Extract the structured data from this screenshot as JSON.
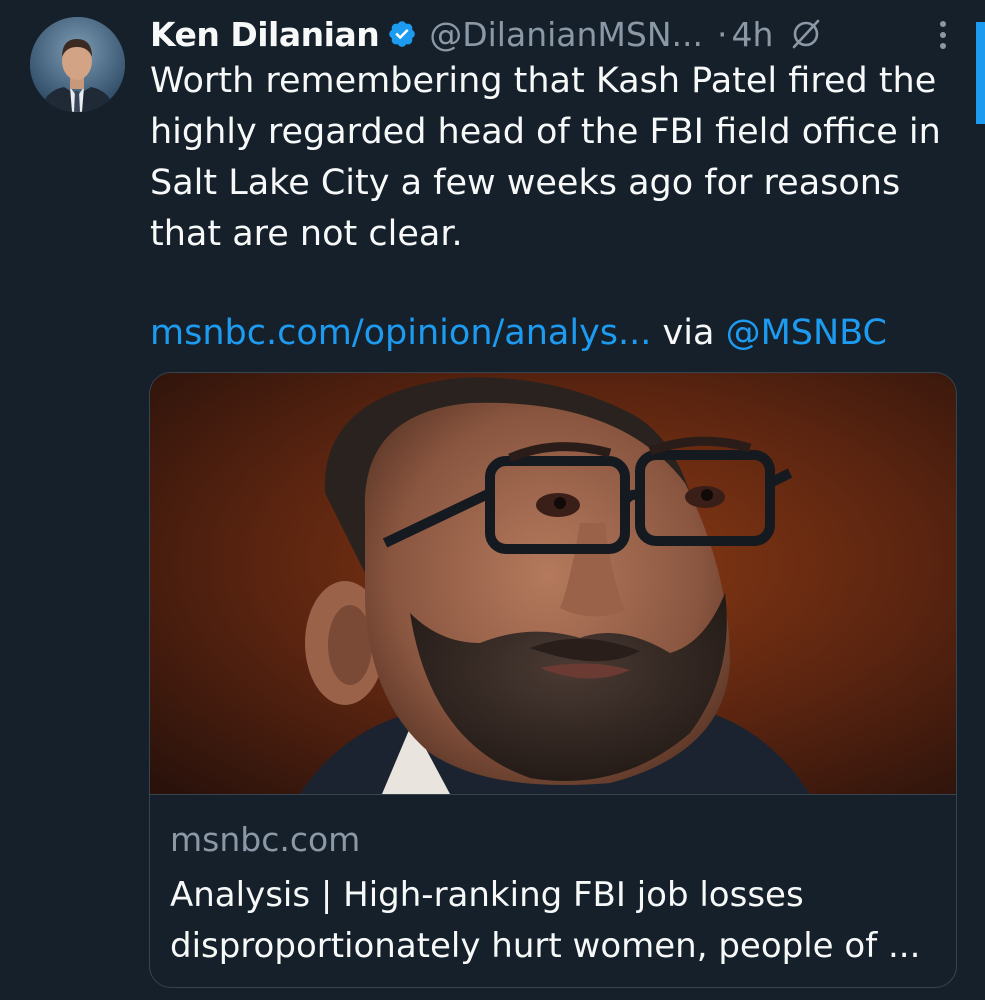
{
  "author": {
    "name": "Ken Dilanian",
    "handle": "@DilanianMSN...",
    "separator": "·",
    "time": "4h"
  },
  "icons": {
    "verified": "verified-badge-icon",
    "grok": "grok-slash-icon",
    "more": "more-vertical-icon"
  },
  "tweet": {
    "text": "Worth remembering that Kash Patel fired the highly regarded head of the FBI field office in Salt Lake City a few weeks ago for reasons that are not clear.",
    "link": "msnbc.com/opinion/analys...",
    "via": " via ",
    "mention": "@MSNBC"
  },
  "card": {
    "domain": "msnbc.com",
    "title": "Analysis | High-ranking FBI job losses disproportionately hurt women, people of ..."
  },
  "colors": {
    "background": "#15202b",
    "accent": "#1d9bf0",
    "secondary_text": "#8b98a5",
    "border": "#38444d"
  }
}
